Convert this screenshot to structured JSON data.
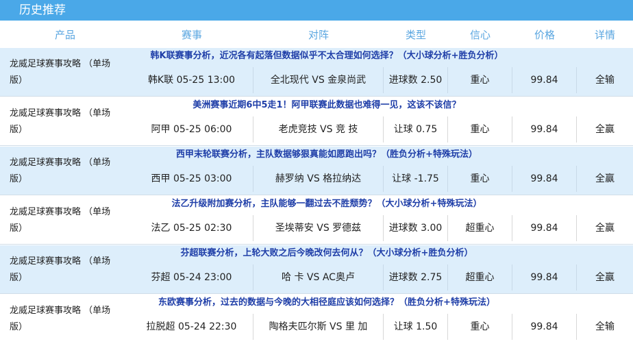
{
  "title": "历史推荐",
  "headers": {
    "product": "产品",
    "match": "赛事",
    "vs": "对阵",
    "type": "类型",
    "confidence": "信心",
    "price": "价格",
    "detail": "详情"
  },
  "records": [
    {
      "headline": "韩K联赛事分析，近况各有起落但数据似乎不太合理如何选择？（大小球分析+胜负分析）",
      "product": "龙威足球赛事攻略 （单场版）",
      "match": "韩K联 05-25 13:00",
      "vs": "全北现代 VS 金泉尚武",
      "type": "进球数 2.50",
      "confidence": "重心",
      "price": "99.84",
      "detail": "全输"
    },
    {
      "headline": "美洲赛事近期6中5走1！阿甲联赛此数据也难得一见，这该不该信？",
      "product": "龙威足球赛事攻略 （单场版）",
      "match": "阿甲 05-25 06:00",
      "vs": "老虎竞技 VS 竞 技",
      "type": "让球 0.75",
      "confidence": "重心",
      "price": "99.84",
      "detail": "全赢"
    },
    {
      "headline": "西甲末轮联赛分析，主队数据够狠真能如愿跑出吗？（胜负分析+特殊玩法）",
      "product": "龙威足球赛事攻略 （单场版）",
      "match": "西甲 05-25 03:00",
      "vs": "赫罗纳 VS 格拉纳达",
      "type": "让球 -1.75",
      "confidence": "重心",
      "price": "99.84",
      "detail": "全赢"
    },
    {
      "headline": "法乙升级附加赛分析，主队能够一翻过去不胜颓势？（大小球分析+特殊玩法）",
      "product": "龙威足球赛事攻略 （单场版）",
      "match": "法乙 05-25 02:30",
      "vs": "圣埃蒂安 VS 罗德兹",
      "type": "进球数 3.00",
      "confidence": "超重心",
      "price": "99.84",
      "detail": "全赢"
    },
    {
      "headline": "芬超联赛分析，上轮大败之后今晚改何去何从？（大小球分析+胜负分析）",
      "product": "龙威足球赛事攻略 （单场版）",
      "match": "芬超 05-24 23:00",
      "vs": "哈 卡 VS AC奥卢",
      "type": "进球数 2.75",
      "confidence": "超重心",
      "price": "99.84",
      "detail": "全赢"
    },
    {
      "headline": "东欧赛事分析，过去的数据与今晚的大相径庭应该如何选择？（胜负分析+特殊玩法）",
      "product": "龙威足球赛事攻略 （单场版）",
      "match": "拉脱超 05-24 22:30",
      "vs": "陶格夫匹尔斯 VS 里 加",
      "type": "让球 1.50",
      "confidence": "重心",
      "price": "99.84",
      "detail": "全输"
    }
  ]
}
